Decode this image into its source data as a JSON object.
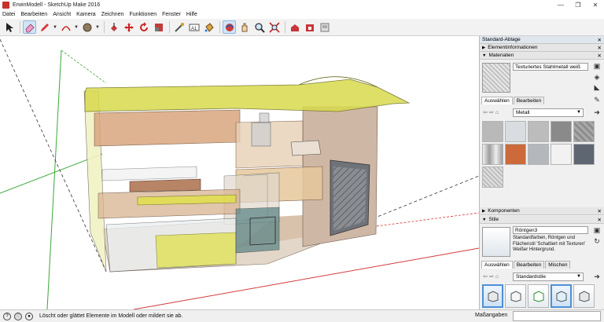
{
  "window": {
    "title": "ErwinModell - SketchUp Make 2016",
    "controls": [
      "—",
      "❐",
      "✕"
    ]
  },
  "menu": [
    "Datei",
    "Bearbeiten",
    "Ansicht",
    "Kamera",
    "Zeichnen",
    "Funktionen",
    "Fenster",
    "Hilfe"
  ],
  "toolbar": {
    "tools": [
      {
        "name": "select-icon",
        "active": false
      },
      {
        "name": "eraser-icon",
        "active": true
      },
      {
        "name": "pencil-icon",
        "active": false
      },
      {
        "name": "arc-icon",
        "active": false
      },
      {
        "name": "circle-shape-icon",
        "active": false
      },
      {
        "name": "push-pull-icon",
        "active": false
      },
      {
        "name": "move-icon",
        "active": false
      },
      {
        "name": "rotate-icon",
        "active": false
      },
      {
        "name": "scale-icon",
        "active": false
      },
      {
        "name": "offset-icon",
        "active": false
      },
      {
        "name": "tape-measure-icon",
        "active": false
      },
      {
        "name": "text-icon",
        "active": false
      },
      {
        "name": "paint-bucket-icon",
        "active": false
      },
      {
        "name": "orbit-icon",
        "active": true
      },
      {
        "name": "pan-icon",
        "active": false
      },
      {
        "name": "zoom-icon",
        "active": false
      },
      {
        "name": "zoom-extents-icon",
        "active": false
      },
      {
        "name": "warehouse-icon",
        "active": false
      },
      {
        "name": "extension-warehouse-icon",
        "active": false
      },
      {
        "name": "layout-icon",
        "active": false
      }
    ]
  },
  "tray": {
    "title": "Standard-Ablage",
    "entity_info_label": "Elementinformationen",
    "materials": {
      "label": "Materialien",
      "current_material": "Texturiertes Stahlmetall weiß",
      "tabs": [
        "Auswählen",
        "Bearbeiten"
      ],
      "library": "Metall",
      "swatches": [
        "#b9b9b9",
        "#d9dde2",
        "#bcbcbc",
        "#8a8a8a",
        "#a8a8a8",
        "#c6c6c6",
        "#cc6a3c",
        "#b4b8bc",
        "#f2f2f2",
        "#5e6672",
        "#d8d8d8"
      ]
    },
    "components_label": "Komponenten",
    "styles": {
      "label": "Stile",
      "current_style": "Röntgen3",
      "description": "Standardfarben, Röntgen und Flächenstil 'Schattiert mit Texturen' Weißer Hintergrund.",
      "tabs": [
        "Auswählen",
        "Bearbeiten",
        "Mischen"
      ],
      "library": "Standardstile"
    }
  },
  "status": {
    "message": "Löscht oder glättet Elemente im Modell oder mildert sie ab.",
    "measurements_label": "Maßangaben",
    "measurements_value": ""
  },
  "colors": {
    "accent": "#4f8fd6",
    "roof": "#d6d84a",
    "wood": "#c7946a"
  }
}
